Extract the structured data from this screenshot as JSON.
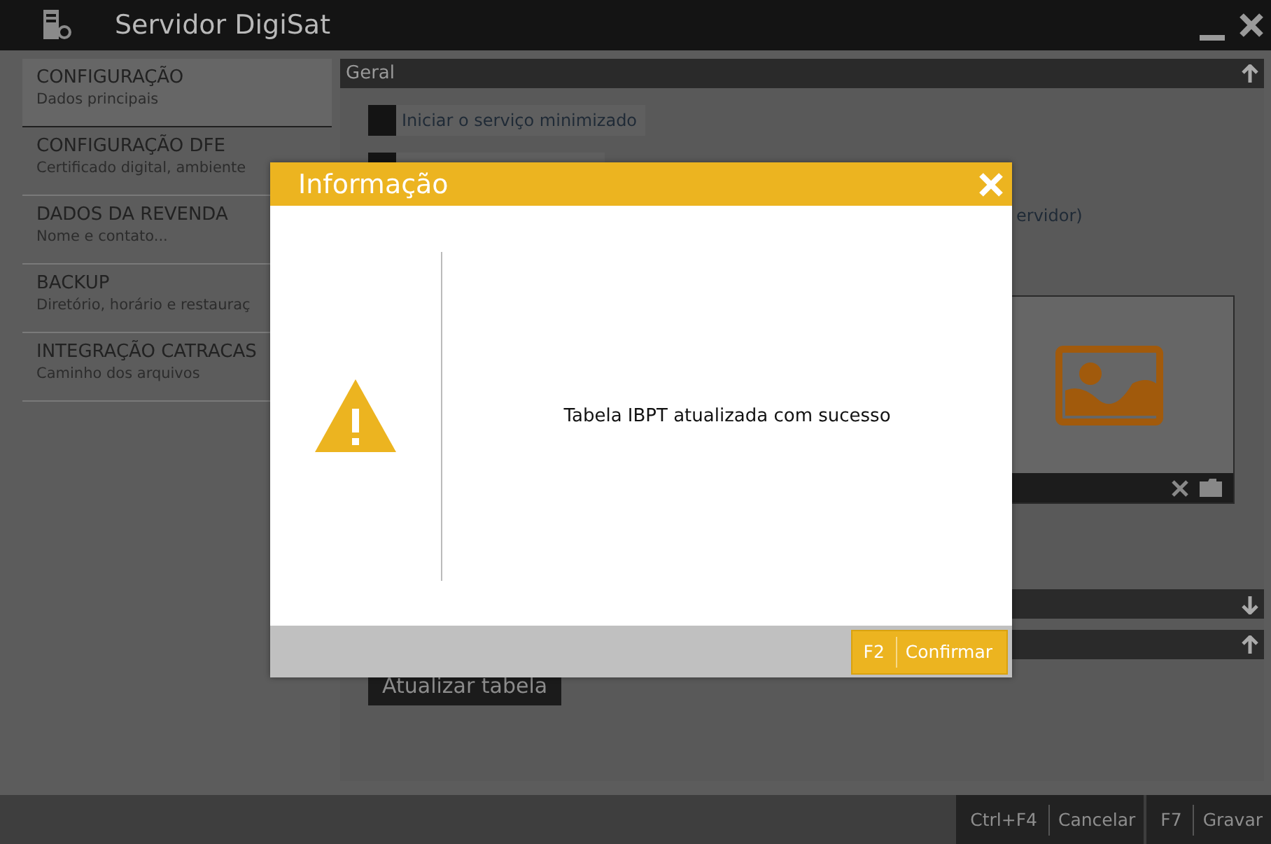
{
  "window": {
    "title": "Servidor DigiSat"
  },
  "sidebar": {
    "items": [
      {
        "title": "CONFIGURAÇÃO",
        "subtitle": "Dados principais",
        "selected": true
      },
      {
        "title": "CONFIGURAÇÃO DFE",
        "subtitle": "Certificado digital, ambiente",
        "selected": false
      },
      {
        "title": "DADOS DA REVENDA",
        "subtitle": "Nome e contato...",
        "selected": false
      },
      {
        "title": "BACKUP",
        "subtitle": "Diretório, horário e restauraç",
        "selected": false
      },
      {
        "title": "INTEGRAÇÃO CATRACAS",
        "subtitle": "Caminho dos arquivos",
        "selected": false
      }
    ]
  },
  "main": {
    "section_title": "Geral",
    "options": [
      {
        "label": "Iniciar o serviço minimizado",
        "checked": false
      }
    ],
    "partial_label": "ervidor)",
    "update_button": "Atualizar tabela"
  },
  "dialog": {
    "title": "Informação",
    "message": "Tabela IBPT atualizada com sucesso",
    "confirm": {
      "key": "F2",
      "label": "Confirmar"
    }
  },
  "footer": {
    "buttons": [
      {
        "key": "Ctrl+F4",
        "label": "Cancelar"
      },
      {
        "key": "F7",
        "label": "Gravar"
      }
    ]
  }
}
